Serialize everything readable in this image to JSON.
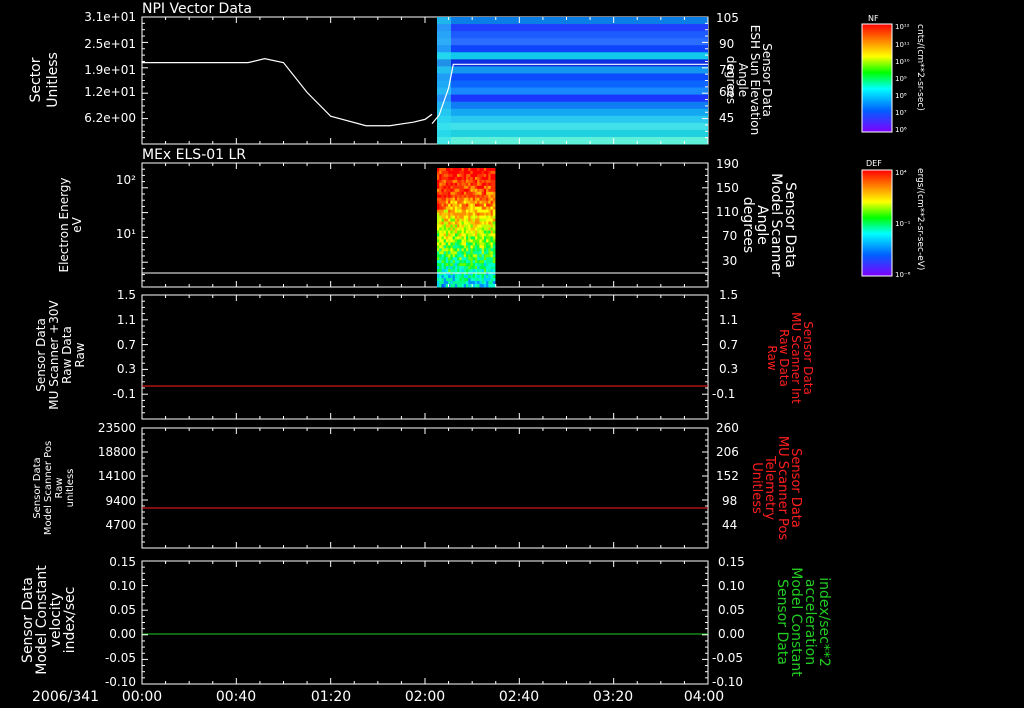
{
  "colors": {
    "red": "#ff1e1e",
    "green": "#22cc22",
    "white": "#ffffff",
    "background": "#000000"
  },
  "x_axis": {
    "date": "2006/341",
    "tick_labels": [
      "00:00",
      "00:40",
      "01:20",
      "02:00",
      "02:40",
      "03:20",
      "04:00"
    ]
  },
  "colorbars": [
    {
      "title": "NF",
      "units": "cnts/(cm**2-sr-sec)",
      "tick_labels": [
        "10¹²",
        "10¹¹",
        "10¹⁰",
        "10⁹",
        "10⁸",
        "10⁷",
        "10⁶"
      ]
    },
    {
      "title": "DEF",
      "units": "ergs/(cm**2-sr-sec-eV)",
      "tick_labels": [
        "10⁴",
        "10⁻¹",
        "10⁻⁶"
      ]
    }
  ],
  "chart_data": [
    {
      "type": "line",
      "title": "NPI Vector Data",
      "ylabel": [
        "Sector",
        "Unitless"
      ],
      "y_ticks": [
        "3.1e+01",
        "2.5e+01",
        "1.9e+01",
        "1.2e+01",
        "6.2e+00"
      ],
      "ylabel_right": [
        "Sensor Data",
        "ESH Sun Elevation",
        "Angle",
        "degrees"
      ],
      "y_right_ticks": [
        "105",
        "90",
        "75",
        "60",
        "45"
      ],
      "series": [
        {
          "color": "#ffffff",
          "x": [
            "00:00",
            "00:45",
            "00:52",
            "01:00",
            "01:10",
            "01:20",
            "01:35",
            "01:45",
            "01:55",
            "02:00",
            "02:03"
          ],
          "y": [
            20.5,
            20.5,
            21.5,
            20.5,
            13,
            7,
            4.6,
            4.6,
            5.5,
            6.2,
            7.5
          ]
        },
        {
          "color": "#ffffff",
          "x": [
            "02:03",
            "02:06",
            "02:10",
            "02:12",
            "02:14",
            "04:00"
          ],
          "y": [
            45,
            50,
            66,
            80,
            80,
            80
          ]
        }
      ],
      "spectrogram": {
        "x_range": [
          "02:00",
          "04:00"
        ]
      }
    },
    {
      "type": "heatmap",
      "title": "MEx ELS-01 LR",
      "ylabel": [
        "Electron Energy",
        "eV"
      ],
      "y_ticks": [
        "10²",
        "10¹"
      ],
      "ylabel_right": [
        "Sensor Data",
        "Model Scanner",
        "Angle",
        "degrees"
      ],
      "y_right_ticks": [
        "190",
        "150",
        "110",
        "70",
        "30"
      ],
      "x_range": [
        "02:00",
        "02:28"
      ],
      "line_y": 5
    },
    {
      "type": "line",
      "ylabel": [
        "Sensor Data",
        "MU Scanner +30V",
        "Raw Data",
        "Raw"
      ],
      "y_ticks": [
        "1.5",
        "1.1",
        "0.7",
        "0.3",
        "-0.1"
      ],
      "ylabel_right": [
        "Sensor Data",
        "MU Scanner Int",
        "Raw Data",
        "Raw"
      ],
      "y_right_ticks": [
        "1.5",
        "1.1",
        "0.7",
        "0.3",
        "-0.1"
      ],
      "ylim": [
        -0.3,
        1.5
      ],
      "series": [
        {
          "color": "#ff1e1e",
          "x": [
            "00:00",
            "04:00"
          ],
          "y": [
            0.1,
            0.1
          ]
        }
      ]
    },
    {
      "type": "line",
      "ylabel": [
        "Sensor Data",
        "Model Scanner Pos",
        "Raw",
        "unitless"
      ],
      "y_ticks": [
        "23500",
        "18800",
        "14100",
        "9400",
        "4700"
      ],
      "ylabel_right": [
        "Sensor Data",
        "MU Scanner Pos",
        "Telemetry",
        "Unitless"
      ],
      "y_right_ticks": [
        "260",
        "206",
        "152",
        "98",
        "44"
      ],
      "ylim": [
        0,
        23500
      ],
      "series": [
        {
          "color": "#ff1e1e",
          "x": [
            "00:00",
            "04:00"
          ],
          "y": [
            8200,
            8200
          ]
        }
      ]
    },
    {
      "type": "line",
      "ylabel": [
        "Sensor Data",
        "Model Constant",
        "velocity",
        "index/sec"
      ],
      "y_ticks": [
        "0.15",
        "0.10",
        "0.05",
        "0.00",
        "-0.05",
        "-0.10"
      ],
      "ylabel_right": [
        "Sensor Data",
        "Model Constant",
        "acceleration",
        "index/sec**2"
      ],
      "y_right_ticks": [
        "0.15",
        "0.10",
        "0.05",
        "0.00",
        "-0.05",
        "-0.10"
      ],
      "ylim": [
        -0.1,
        0.15
      ],
      "series": [
        {
          "color": "#22cc22",
          "x": [
            "00:00",
            "04:00"
          ],
          "y": [
            0.0,
            0.0
          ]
        }
      ]
    }
  ]
}
